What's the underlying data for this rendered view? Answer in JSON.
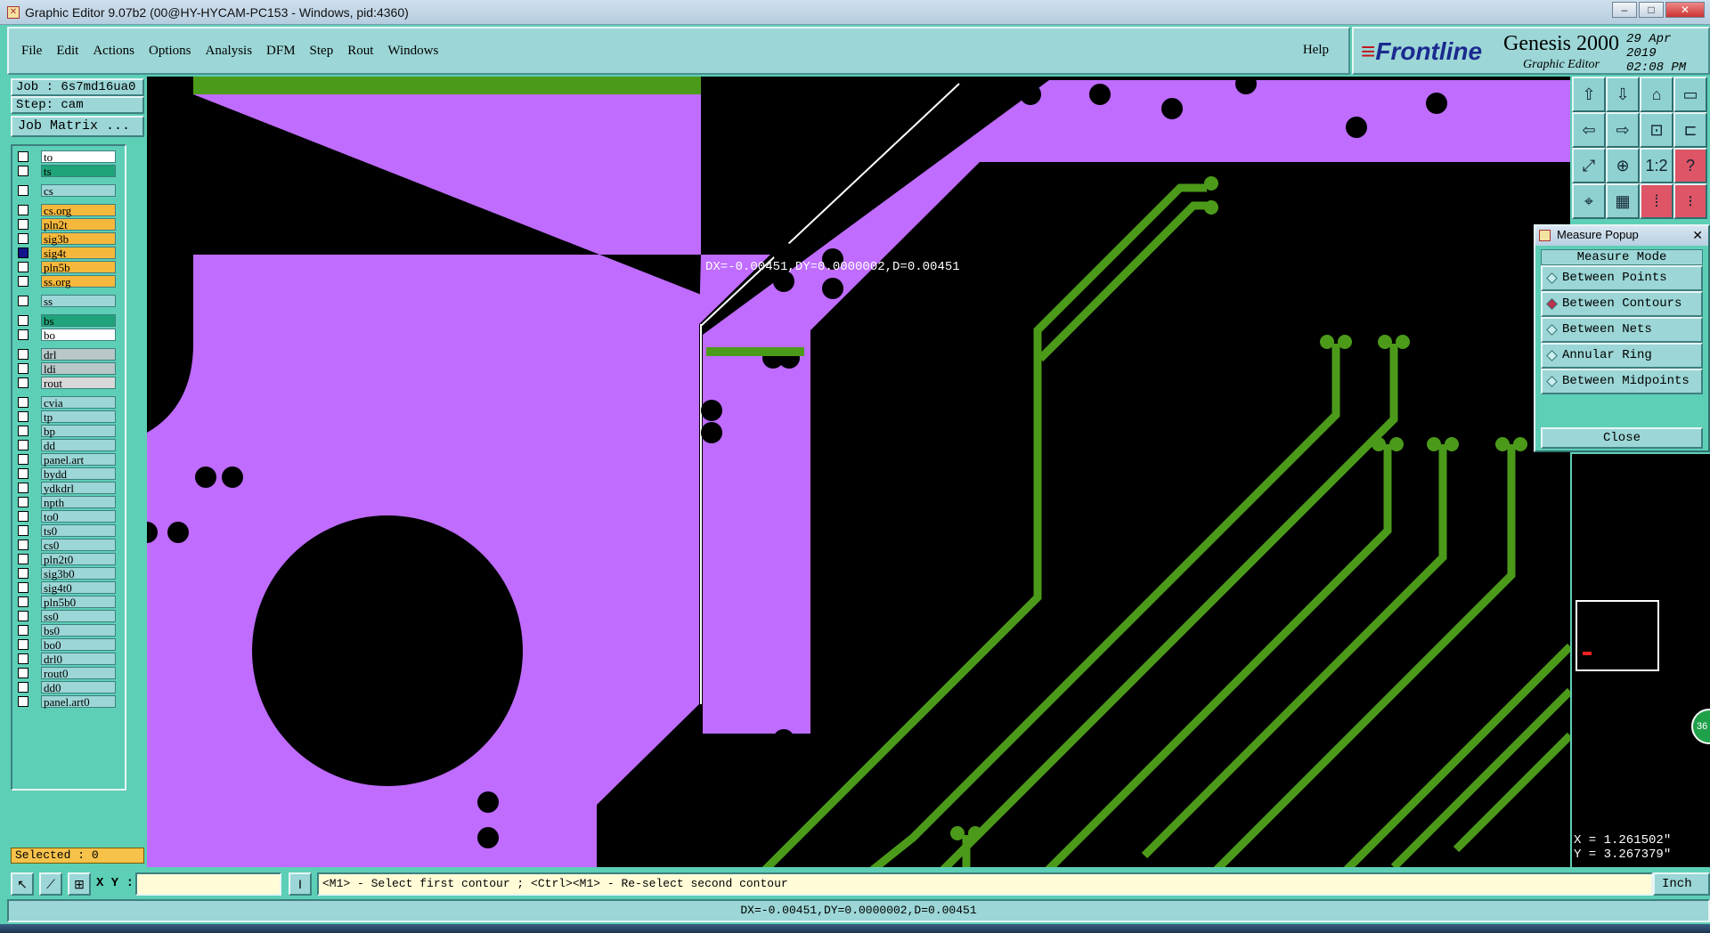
{
  "window": {
    "title": "Graphic Editor 9.07b2 (00@HY-HYCAM-PC153 - Windows, pid:4360)"
  },
  "menu": {
    "items": [
      "File",
      "Edit",
      "Actions",
      "Options",
      "Analysis",
      "DFM",
      "Step",
      "Rout",
      "Windows"
    ],
    "help": "Help"
  },
  "brand": {
    "logo": "Frontline",
    "product": "Genesis 2000",
    "subtitle": "Graphic Editor",
    "date": "29 Apr 2019",
    "time": "02:08 PM"
  },
  "job": {
    "job_label": "Job : 6s7md16ua0",
    "step_label": "Step: cam",
    "matrix_button": "Job Matrix ..."
  },
  "layers": [
    {
      "name": "to",
      "color": "#ffffff",
      "selected": false
    },
    {
      "name": "ts",
      "color": "#1fa37a",
      "selected": false
    },
    {
      "gap": true
    },
    {
      "name": "cs",
      "color": "#9cd6d6",
      "selected": false
    },
    {
      "gap": true
    },
    {
      "name": "cs.org",
      "color": "#f6b83c",
      "selected": false
    },
    {
      "name": "pln2t",
      "color": "#f6b83c",
      "selected": false
    },
    {
      "name": "sig3b",
      "color": "#f6b83c",
      "selected": false
    },
    {
      "name": "sig4t",
      "color": "#f6b83c",
      "selected": true
    },
    {
      "name": "pln5b",
      "color": "#f6b83c",
      "selected": false
    },
    {
      "name": "ss.org",
      "color": "#f6b83c",
      "selected": false
    },
    {
      "gap": true
    },
    {
      "name": "ss",
      "color": "#9cd6d6",
      "selected": false
    },
    {
      "gap": true
    },
    {
      "name": "bs",
      "color": "#1fa37a",
      "selected": false
    },
    {
      "name": "bo",
      "color": "#ffffff",
      "selected": false
    },
    {
      "gap": true
    },
    {
      "name": "drl",
      "color": "#b8c8c8",
      "selected": false
    },
    {
      "name": "ldi",
      "color": "#b8c8c8",
      "selected": false
    },
    {
      "name": "rout",
      "color": "#d8d8d8",
      "selected": false
    },
    {
      "gap": true
    },
    {
      "name": "cvia",
      "color": "#9cd6d6",
      "selected": false
    },
    {
      "name": "tp",
      "color": "#9cd6d6",
      "selected": false
    },
    {
      "name": "bp",
      "color": "#9cd6d6",
      "selected": false
    },
    {
      "name": "dd",
      "color": "#9cd6d6",
      "selected": false
    },
    {
      "name": "panel.art",
      "color": "#9cd6d6",
      "selected": false
    },
    {
      "name": "bydd",
      "color": "#9cd6d6",
      "selected": false
    },
    {
      "name": "ydkdrl",
      "color": "#9cd6d6",
      "selected": false
    },
    {
      "name": "npth",
      "color": "#9cd6d6",
      "selected": false
    },
    {
      "name": "to0",
      "color": "#9cd6d6",
      "selected": false
    },
    {
      "name": "ts0",
      "color": "#9cd6d6",
      "selected": false
    },
    {
      "name": "cs0",
      "color": "#9cd6d6",
      "selected": false
    },
    {
      "name": "pln2t0",
      "color": "#9cd6d6",
      "selected": false
    },
    {
      "name": "sig3b0",
      "color": "#9cd6d6",
      "selected": false
    },
    {
      "name": "sig4t0",
      "color": "#9cd6d6",
      "selected": false
    },
    {
      "name": "pln5b0",
      "color": "#9cd6d6",
      "selected": false
    },
    {
      "name": "ss0",
      "color": "#9cd6d6",
      "selected": false
    },
    {
      "name": "bs0",
      "color": "#9cd6d6",
      "selected": false
    },
    {
      "name": "bo0",
      "color": "#9cd6d6",
      "selected": false
    },
    {
      "name": "drl0",
      "color": "#9cd6d6",
      "selected": false
    },
    {
      "name": "rout0",
      "color": "#9cd6d6",
      "selected": false
    },
    {
      "name": "dd0",
      "color": "#9cd6d6",
      "selected": false
    },
    {
      "name": "panel.art0",
      "color": "#9cd6d6",
      "selected": false
    }
  ],
  "selected_label": "Selected : 0",
  "canvas": {
    "measure_text": "DX=-0.00451,DY=0.0000002,D=0.00451",
    "copper_color": "#bf6cff",
    "trace_color": "#4c9a1a"
  },
  "measure_popup": {
    "title": "Measure Popup",
    "heading": "Measure Mode",
    "modes": [
      {
        "label": "Between Points",
        "active": false
      },
      {
        "label": "Between Contours",
        "active": true
      },
      {
        "label": "Between Nets",
        "active": false
      },
      {
        "label": "Annular Ring",
        "active": false
      },
      {
        "label": "Between Midpoints",
        "active": false
      }
    ],
    "close_label": "Close"
  },
  "coords": {
    "x": "X = 1.261502\"",
    "y": "Y = 3.267379\"",
    "badge": "36"
  },
  "command": {
    "xy_label": "X Y :",
    "xy_value": "",
    "prompt": "<M1> - Select first contour ; <Ctrl><M1> - Re-select second contour",
    "units": "Inch"
  },
  "status": "DX=-0.00451,DY=0.0000002,D=0.00451"
}
